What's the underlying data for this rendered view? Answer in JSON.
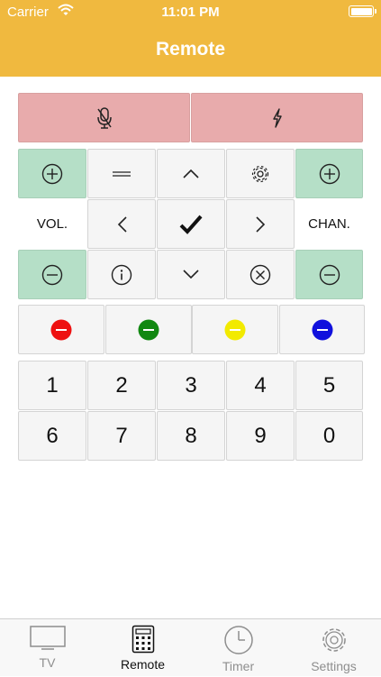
{
  "status_bar": {
    "carrier": "Carrier",
    "time": "11:01 PM"
  },
  "nav": {
    "title": "Remote"
  },
  "remote": {
    "vol_label": "VOL.",
    "chan_label": "CHAN.",
    "numbers": [
      "1",
      "2",
      "3",
      "4",
      "5",
      "6",
      "7",
      "8",
      "9",
      "0"
    ],
    "color_buttons": [
      "#ee1111",
      "#118811",
      "#f2ea00",
      "#1111dd"
    ]
  },
  "tabs": [
    {
      "label": "TV",
      "icon": "tv-icon",
      "active": false
    },
    {
      "label": "Remote",
      "icon": "calculator-icon",
      "active": true
    },
    {
      "label": "Timer",
      "icon": "clock-icon",
      "active": false
    },
    {
      "label": "Settings",
      "icon": "gear-icon",
      "active": false
    }
  ]
}
